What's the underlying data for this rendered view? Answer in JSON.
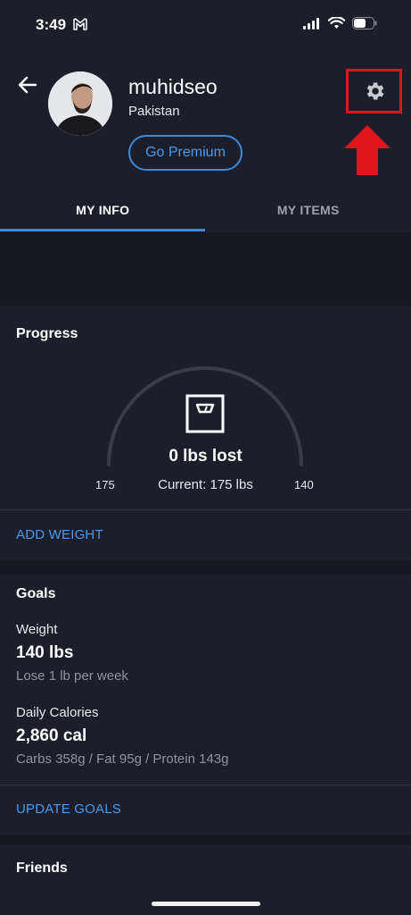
{
  "status_bar": {
    "time": "3:49",
    "mail_icon": "gmail-icon",
    "signal_icon": "cellular-signal-icon",
    "wifi_icon": "wifi-icon",
    "battery_icon": "battery-icon"
  },
  "profile": {
    "username": "muhidseo",
    "country": "Pakistan",
    "premium_label": "Go Premium",
    "back_icon": "back-arrow-icon",
    "settings_icon": "gear-icon",
    "highlight_color": "#e0161c"
  },
  "tabs": [
    {
      "label": "MY INFO",
      "active": true
    },
    {
      "label": "MY ITEMS",
      "active": false
    }
  ],
  "progress": {
    "title": "Progress",
    "lost": "0 lbs lost",
    "current": "Current: 175 lbs",
    "start": "175",
    "goal": "140",
    "icon": "scale-icon",
    "fraction": 0,
    "action": "ADD WEIGHT"
  },
  "goals": {
    "title": "Goals",
    "weight_label": "Weight",
    "weight_value": "140 lbs",
    "weight_sub": "Lose 1 lb per week",
    "calories_label": "Daily Calories",
    "calories_value": "2,860 cal",
    "calories_sub": "Carbs 358g / Fat 95g / Protein 143g",
    "action": "UPDATE GOALS"
  },
  "friends": {
    "title": "Friends"
  },
  "colors": {
    "accent": "#3d8bd9",
    "background": "#161821",
    "card": "#1c1e2b"
  }
}
